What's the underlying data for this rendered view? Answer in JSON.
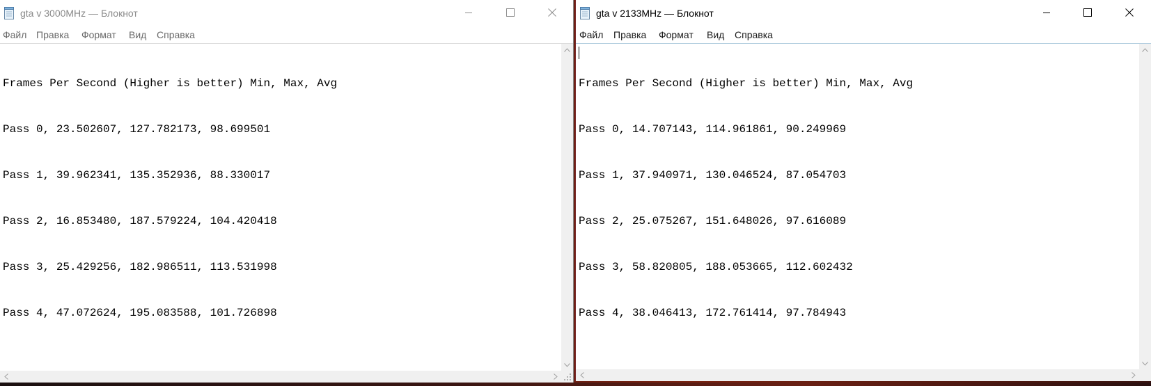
{
  "windows": [
    {
      "title": "gta v 3000MHz — Блокнот",
      "active": false,
      "menu": [
        "Файл",
        "Правка",
        "Формат",
        "Вид",
        "Справка"
      ],
      "lines": [
        "Frames Per Second (Higher is better) Min, Max, Avg",
        "Pass 0, 23.502607, 127.782173, 98.699501",
        "Pass 1, 39.962341, 135.352936, 88.330017",
        "Pass 2, 16.853480, 187.579224, 104.420418",
        "Pass 3, 25.429256, 182.986511, 113.531998",
        "Pass 4, 47.072624, 195.083588, 101.726898"
      ]
    },
    {
      "title": "gta v 2133MHz — Блокнот",
      "active": true,
      "menu": [
        "Файл",
        "Правка",
        "Формат",
        "Вид",
        "Справка"
      ],
      "lines": [
        "Frames Per Second (Higher is better) Min, Max, Avg",
        "Pass 0, 14.707143, 114.961861, 90.249969",
        "Pass 1, 37.940971, 130.046524, 87.054703",
        "Pass 2, 25.075267, 151.648026, 97.616089",
        "Pass 3, 58.820805, 188.053665, 112.602432",
        "Pass 4, 38.046413, 172.761414, 97.784943"
      ]
    }
  ],
  "icons": {
    "app": "notepad-icon",
    "minimize": "minimize-icon",
    "maximize": "maximize-icon",
    "close": "close-icon"
  },
  "colors": {
    "inactive_text": "#8a8a8a",
    "active_text": "#000000",
    "scrollbar": "#f0f0f0",
    "menu_divider_active": "#b4cfe0"
  }
}
